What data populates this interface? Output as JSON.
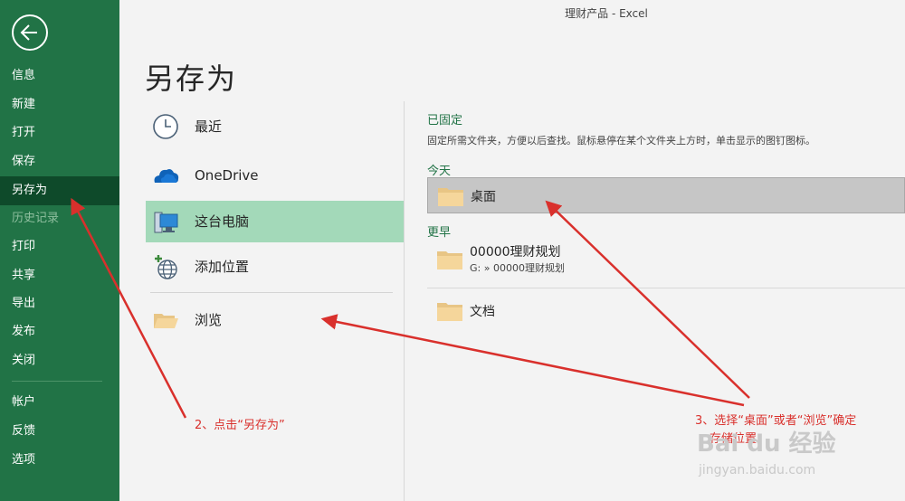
{
  "window_title": "理财产品  -  Excel",
  "sidebar": {
    "items": [
      {
        "label": "信息"
      },
      {
        "label": "新建"
      },
      {
        "label": "打开"
      },
      {
        "label": "保存"
      },
      {
        "label": "另存为"
      },
      {
        "label": "历史记录"
      },
      {
        "label": "打印"
      },
      {
        "label": "共享"
      },
      {
        "label": "导出"
      },
      {
        "label": "发布"
      },
      {
        "label": "关闭"
      },
      {
        "label": "帐户"
      },
      {
        "label": "反馈"
      },
      {
        "label": "选项"
      }
    ]
  },
  "page_title": "另存为",
  "locations": [
    {
      "label": "最近",
      "icon": "clock-icon"
    },
    {
      "label": "OneDrive",
      "icon": "cloud-icon"
    },
    {
      "label": "这台电脑",
      "icon": "computer-icon"
    },
    {
      "label": "添加位置",
      "icon": "globe-add-icon"
    },
    {
      "label": "浏览",
      "icon": "folder-open-icon"
    }
  ],
  "right_panel": {
    "pinned_title": "已固定",
    "pinned_desc": "固定所需文件夹，方便以后查找。鼠标悬停在某个文件夹上方时，单击显示的图钉图标。",
    "today_title": "今天",
    "today_folder": "桌面",
    "earlier_title": "更早",
    "earlier_folders": [
      {
        "name": "00000理财规划",
        "path": "G: » 00000理财规划"
      },
      {
        "name": "文档"
      }
    ]
  },
  "annotations": {
    "step2": "2、点击“另存为”",
    "step3_line1": "3、选择“桌面”或者“浏览”确定",
    "step3_line2": "存储位置"
  },
  "watermark": {
    "brand": "Bai du 经验",
    "url": "jingyan.baidu.com"
  },
  "colors": {
    "sidebar_bg": "#217346",
    "sidebar_active": "#0e4a2a",
    "location_active": "#a3d9b9",
    "accent_green": "#217346",
    "annotation_red": "#d9302c"
  }
}
